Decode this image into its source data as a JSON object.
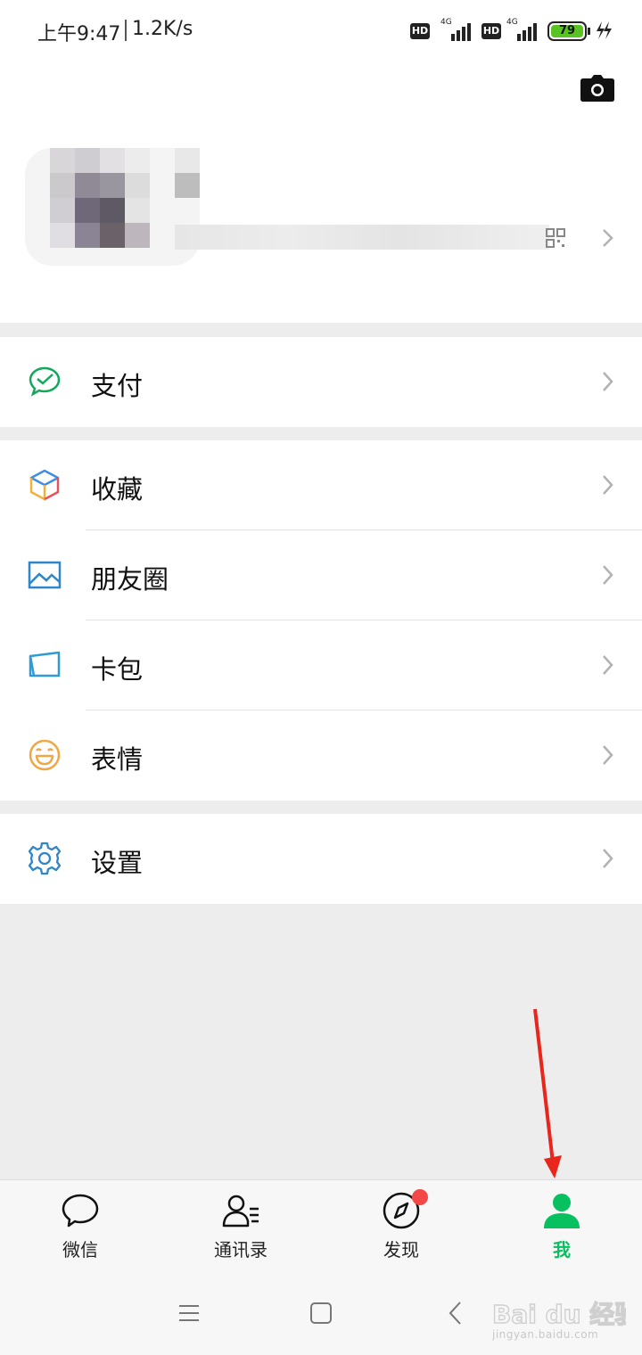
{
  "status_bar": {
    "time": "上午9:47",
    "speed": "1.2K/s",
    "hd_label": "HD",
    "network_label": "4G",
    "battery_level": "79"
  },
  "profile": {
    "camera_icon": "camera-icon",
    "qr_icon": "qr-code-icon"
  },
  "menu": {
    "groups": [
      [
        {
          "label": "支付",
          "icon": "pay-icon"
        }
      ],
      [
        {
          "label": "收藏",
          "icon": "favorites-cube-icon"
        },
        {
          "label": "朋友圈",
          "icon": "moments-picture-icon"
        },
        {
          "label": "卡包",
          "icon": "card-wallet-icon"
        },
        {
          "label": "表情",
          "icon": "sticker-smile-icon"
        }
      ],
      [
        {
          "label": "设置",
          "icon": "settings-gear-icon"
        }
      ]
    ]
  },
  "tabbar": {
    "tabs": [
      {
        "label": "微信",
        "icon": "chat-bubble-icon",
        "active": false
      },
      {
        "label": "通讯录",
        "icon": "contacts-icon",
        "active": false
      },
      {
        "label": "发现",
        "icon": "compass-icon",
        "active": false,
        "badge": "dot"
      },
      {
        "label": "我",
        "icon": "person-icon",
        "active": true
      }
    ]
  },
  "nav": {
    "buttons": [
      "menu-icon",
      "home-square-icon",
      "back-chevron-icon"
    ]
  },
  "annotation": {
    "arrow_color": "#e8261c"
  },
  "watermark": {
    "brand": "Bai du 经验",
    "url": "jingyan.baidu.com"
  },
  "colors": {
    "accent_green": "#07c160",
    "badge_red": "#f24848"
  }
}
